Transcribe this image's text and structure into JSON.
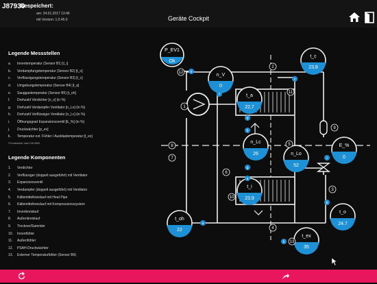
{
  "header": {
    "device_id": "J87930",
    "saved_label": "Gespeichert:",
    "saved_date_line": "am: 24.01.2017 13:46",
    "version_line": "mit Version: 1.0.45.0",
    "title": "Geräte Cockpit"
  },
  "legend_messstellen": {
    "title": "Legende Messstellen",
    "items": [
      {
        "key": "a.",
        "text": "Innentemperatur (Sensor B1)  [t_i]"
      },
      {
        "key": "b.",
        "text": "Verdampfungstemperatur (Sensor B2)  [t_o]"
      },
      {
        "key": "c.",
        "text": "Verflüssigungstemperatur (Sensor B3)  [t_c]"
      },
      {
        "key": "d.",
        "text": "Umgebungstemperatur (Sensor B4)  [t_a]"
      },
      {
        "key": "e.",
        "text": "Sauggastemperatur (Sensor B5)  [t_oh]"
      },
      {
        "key": "f.",
        "text": "Drehzahl Verdichter  [n_v] (in %)"
      },
      {
        "key": "g.",
        "text": "Drehzahl Verdampfer Ventilator  [n_Lo] (in %)"
      },
      {
        "key": "h.",
        "text": "Drehzahl Verflüssiger Ventilator  [n_Lc] (in %)"
      },
      {
        "key": "i.",
        "text": "Öffnungsgrad Expansionsventil  [E_%] (in %)"
      },
      {
        "key": "j.",
        "text": "Druckwächter  [p_ev]"
      },
      {
        "key": "k.",
        "text": "Temperatur ext. Fühler / Ausblastemperatur  [t_ex]"
      }
    ],
    "footnote": "*Fernabsteller nach DIN 6965"
  },
  "legend_komponenten": {
    "title": "Legende Komponenten",
    "items": [
      {
        "key": "1.",
        "text": "Verdichter"
      },
      {
        "key": "2.",
        "text": "Verflüssiger (doppelt ausgeführt) mit Ventilator"
      },
      {
        "key": "3.",
        "text": "Expansionsventil"
      },
      {
        "key": "4.",
        "text": "Verdampfer (doppelt ausgeführt) mit Ventilator"
      },
      {
        "key": "5.",
        "text": "Kältemittelkreislauf mit Heat Pipe"
      },
      {
        "key": "6.",
        "text": "Kältemittelkreislauf mit Kompressionssystem"
      },
      {
        "key": "7.",
        "text": "Innenkreislauf"
      },
      {
        "key": "8.",
        "text": "Außenkreislauf"
      },
      {
        "key": "9.",
        "text": "Trockner/Sammler"
      },
      {
        "key": "10.",
        "text": "Innenfühler"
      },
      {
        "key": "11.",
        "text": "Außenfühler"
      },
      {
        "key": "12.",
        "text": "PSAH-Druckwächter"
      },
      {
        "key": "13.",
        "text": "Externer Temperaturfühler (Sensor B6)"
      }
    ]
  },
  "sensors": {
    "pev": {
      "label": "P_EV1",
      "value": "Ok"
    },
    "tc": {
      "label": "t_c",
      "value": "23.8"
    },
    "nv": {
      "label": "n_V",
      "value": "0"
    },
    "ta": {
      "label": "t_a",
      "value": "22,7"
    },
    "nlc": {
      "label": "n_Lc",
      "value": "26"
    },
    "nlo": {
      "label": "n_Lo",
      "value": "52"
    },
    "epct": {
      "label": "E_%",
      "value": "0"
    },
    "ti": {
      "label": "t_i",
      "value": "23.9"
    },
    "toh": {
      "label": "t_oh",
      "value": "22"
    },
    "tex": {
      "label": "t_ex",
      "value": "35"
    },
    "to": {
      "label": "t_o",
      "value": "24.7"
    }
  },
  "point_letters": {
    "a": "a",
    "b": "b",
    "c": "c",
    "d": "d",
    "e": "e",
    "f": "f",
    "g": "g",
    "h": "h",
    "i": "i",
    "k": "k"
  },
  "component_numbers": [
    "1",
    "2",
    "3",
    "4",
    "5",
    "6",
    "7",
    "8",
    "9",
    "10",
    "11",
    "12",
    "13"
  ],
  "icons": {
    "home": "home-icon",
    "exit": "exit-icon",
    "refresh": "refresh-icon",
    "share": "share-icon"
  },
  "colors": {
    "sensor_fill": "#1e90d6",
    "accent_footer": "#e8175d",
    "line": "#f0f0f0"
  }
}
